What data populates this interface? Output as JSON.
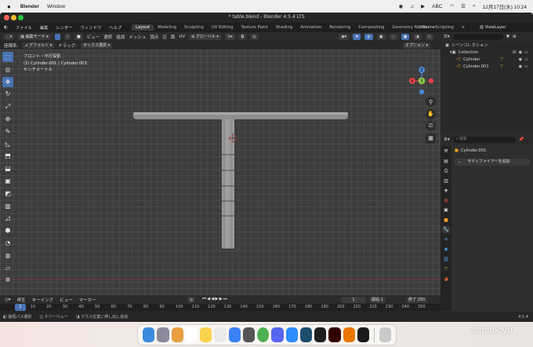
{
  "mac_menubar": {
    "apple": "",
    "app": "Blender",
    "menus": [
      "Window"
    ],
    "date_time": "12月17日(水)  10:24",
    "keyboard": "ABC"
  },
  "window": {
    "title": "* table.blend - Blender 4.5.4 LTS"
  },
  "topbar": {
    "menus": [
      "ファイル",
      "編集",
      "レンダー",
      "ウィンドウ",
      "ヘルプ"
    ],
    "workspaces": [
      "Layout",
      "Modeling",
      "Sculpting",
      "UV Editing",
      "Texture Paint",
      "Shading",
      "Animation",
      "Rendering",
      "Compositing",
      "Geometry Nodes",
      "Scripting"
    ],
    "active_workspace": "Layout",
    "scene": "Scene",
    "view_layer": "ViewLayer"
  },
  "viewport_header": {
    "mode": "編集モード",
    "menus": [
      "ビュー",
      "選択",
      "追加",
      "メッシュ",
      "頂点",
      "辺",
      "面",
      "UV"
    ],
    "transform": "グローバル",
    "coord_label": "座標系:",
    "orientation": "デフォルト",
    "drag_label": "ドラッグ:",
    "drag": "ボックス選択",
    "options": "オプション"
  },
  "viewport_info": {
    "line1": "フロント・平行投影",
    "line2": "(1) Cylinder.001 | Cylinder.003",
    "line3": "センチメートル"
  },
  "gizmo": {
    "x": "X",
    "y": "Y",
    "z": "Z"
  },
  "timeline": {
    "menus": [
      "再生",
      "キーイング",
      "ビュー",
      "マーカー"
    ],
    "current_frame": "1",
    "start_label": "開始",
    "start": "1",
    "end_label": "終了",
    "end": "250",
    "ruler": [
      "1",
      "10",
      "20",
      "30",
      "40",
      "50",
      "60",
      "70",
      "80",
      "90",
      "100",
      "110",
      "120",
      "130",
      "140",
      "150",
      "160",
      "170",
      "180",
      "190",
      "200",
      "210",
      "220",
      "230",
      "240",
      "250"
    ]
  },
  "status_bar": {
    "hints": [
      "最短パス選択",
      "ドリーベュー",
      "マウス位置に押し出し追加"
    ],
    "version": "4.5.4"
  },
  "outliner": {
    "search_placeholder": "",
    "root": "シーンコレクション",
    "collection": "Collection",
    "objects": [
      "Cylinder",
      "Cylinder.001"
    ]
  },
  "properties": {
    "search_placeholder": "検索",
    "object": "Cylinder.001",
    "add_modifier": "モディファイアーを追加"
  },
  "watermark": "©itsukiyu",
  "colors": {
    "accent": "#4772b3",
    "axis_x": "#e0424a",
    "axis_y": "#8bc24a",
    "axis_z": "#4f86d8",
    "selection": "#f0a020"
  }
}
